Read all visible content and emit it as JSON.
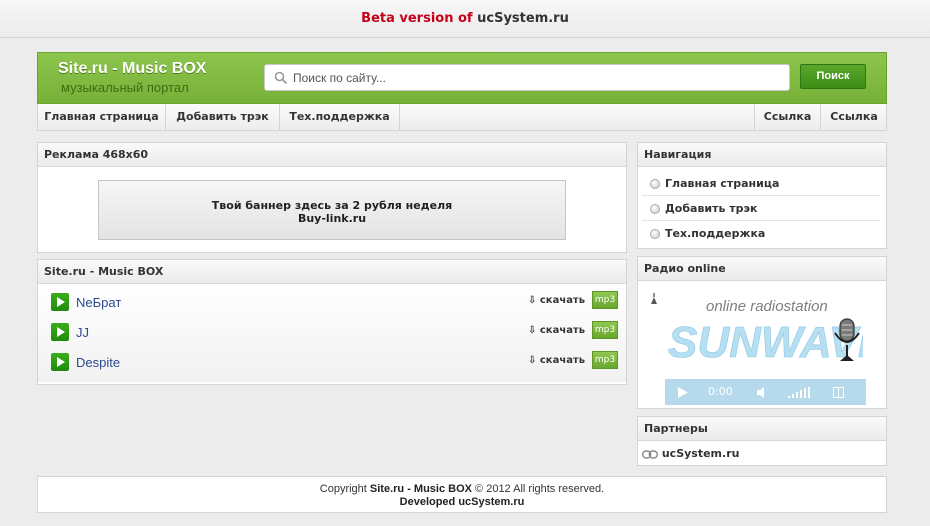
{
  "beta_bar": {
    "prefix": "Beta version of",
    "site": "ucSystem.ru"
  },
  "header": {
    "logo_title": "Site.ru - Music BOX",
    "logo_subtitle": "музыкальный портал",
    "search_placeholder": "Поиск по сайту...",
    "search_button": "Поиск"
  },
  "topnav": {
    "left": [
      "Главная страница",
      "Добавить трэк",
      "Тех.поддержка"
    ],
    "right": [
      "Ссылка",
      "Ссылка"
    ]
  },
  "ad_panel": {
    "title": "Реклама 468x60",
    "banner_line1": "Твой баннер здесь за 2 рубля неделя",
    "banner_line2": "Buy-link.ru"
  },
  "music_panel": {
    "title": "Site.ru - Music BOX",
    "download_label": "⇩ скачать",
    "format_badge": "mp3",
    "tracks": [
      "NeБрат",
      "JJ",
      "Despite"
    ]
  },
  "nav_panel": {
    "title": "Навигация",
    "items": [
      "Главная страница",
      "Добавить трэк",
      "Тех.поддержка"
    ]
  },
  "radio_panel": {
    "title": "Радио online",
    "logo_tagline": "online radiostation",
    "logo_name": "SUNWAVE",
    "player_time": "0:00"
  },
  "partners_panel": {
    "title": "Партнеры",
    "link": "ucSystem.ru"
  },
  "footer": {
    "copyright_prefix": "Copyright",
    "site_name": "Site.ru - Music BOX",
    "copyright_suffix": "© 2012 All rights reserved.",
    "developed": "Developed ucSystem.ru"
  },
  "colors": {
    "accent_green": "#77b138",
    "beta_red": "#c8001a",
    "track_link": "#2c4a8c",
    "radio_blue": "#b7d9ec"
  }
}
